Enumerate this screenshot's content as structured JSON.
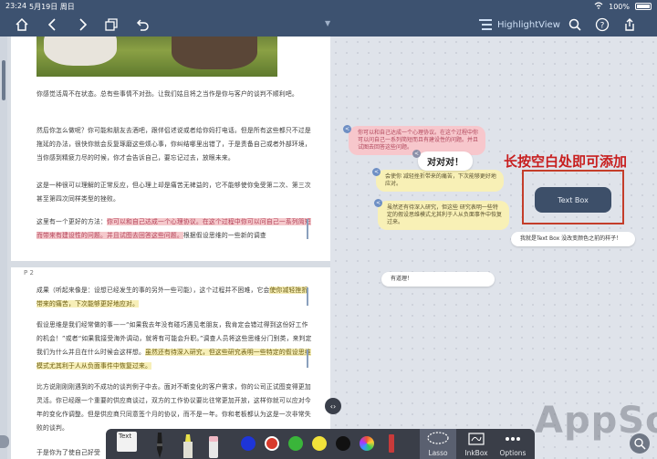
{
  "status_bar": {
    "time": "23:24",
    "date": "5月19日 周日",
    "battery": "100%"
  },
  "toolbar": {
    "view_label": "HighlightView"
  },
  "document": {
    "page1": {
      "para1": "你感觉活周不在状态。总有些事情不对劲。让我们姑且将之当作是你与客户的谈判不顺利吧。",
      "para2": "然后你怎么做呢？你可能和朋友去酒吧，跟伴侣述说或者给你妈打电话。但是所有这些都只不过是拖延的办法，很快你就会反复琢磨这些烦心事，你纠结哪里出错了，于是责备自己或者外部环境，当你感到精疲力尽的时候，你才会告诉自己，要忘记过去，放眼未来。",
      "para3": "这是一种很可以理解的正常反应，但心理上却是痛苦无裨益的，它不能够使你免受第二次、第三次甚至第四次同样类型的挫败。",
      "para4_lead": "这里有一个更好的方法：",
      "para4_pink": "你可以和自己达成一个心理协议。在这个过程中你可以问自己一系列简短而带来有建设性的问题。并且试图去回答这些问题。",
      "para4_tail": "根据假设思维的一些新的调查"
    },
    "page2": {
      "label": "P 2",
      "para1_lead": "成果（听起来像是：设想已经发生的事的另外一些可能），这个过程并不困难，它会",
      "para1_yellow": "使你减轻挫折带来的痛苦，下次能够更好地应对。",
      "para2": "假设思维是我们经常做的事——“如果我去年没有碰巧遇见老朋友，我肯定会错过得到这份好工作的机会！”或者“如果我接受海外调动，就将有可能会升职。”调查人员将这些思维分门别类，来判定我们为什么并且在什么时候会这样想。",
      "para2_yellow": "虽然还有待深入研究，但这些研究表明一些特定的假设思维模式尤其利于人从负面事件中恢复过来。",
      "para3": "比方说刚刚刚遇到的不成功的谈判例子中去。面对不断变化的客户需求，你的公司正试图变得更加灵活。你已经跟一个重要的供应商谈过，双方的工作协议要比往常更加开放，这样你就可以应对今年的变化作调整。但是供应商只同意签个月的协议，而不是一年。你和老板都认为这是一次非常失败的谈判。",
      "para4": "于是你为了使自己好受"
    }
  },
  "canvas": {
    "note_pink": "你可以和自己达成一个心理协议。在这个过程中你可以问自己一系列简短而且有建设性的问题。并且试图去回答这些问题。",
    "note_yellow1": "会使你 减轻挫折带来的痛苦，下次能够更好地应对。",
    "note_yellow2": "虽然还有待深入研究，但这些 研究表明一些特定的假设思维模式尤其利于人从负面事件中恢复过来。",
    "bubble": "对对对！",
    "hint": "长按空白处即可添加",
    "text_box": "Text Box",
    "note_white1": "我就是Text Box 没改变颜色之前的样子！",
    "note_white2": "有道理！"
  },
  "pen_toolbar": {
    "text_label": "Text",
    "lasso_label": "Lasso",
    "inkbox_label": "InkBox",
    "options_label": "Options",
    "colors": [
      "#1e35d8",
      "#d83a2c",
      "#3ab53a",
      "#f2e23a",
      "#111111"
    ]
  },
  "watermark": "AppSo"
}
